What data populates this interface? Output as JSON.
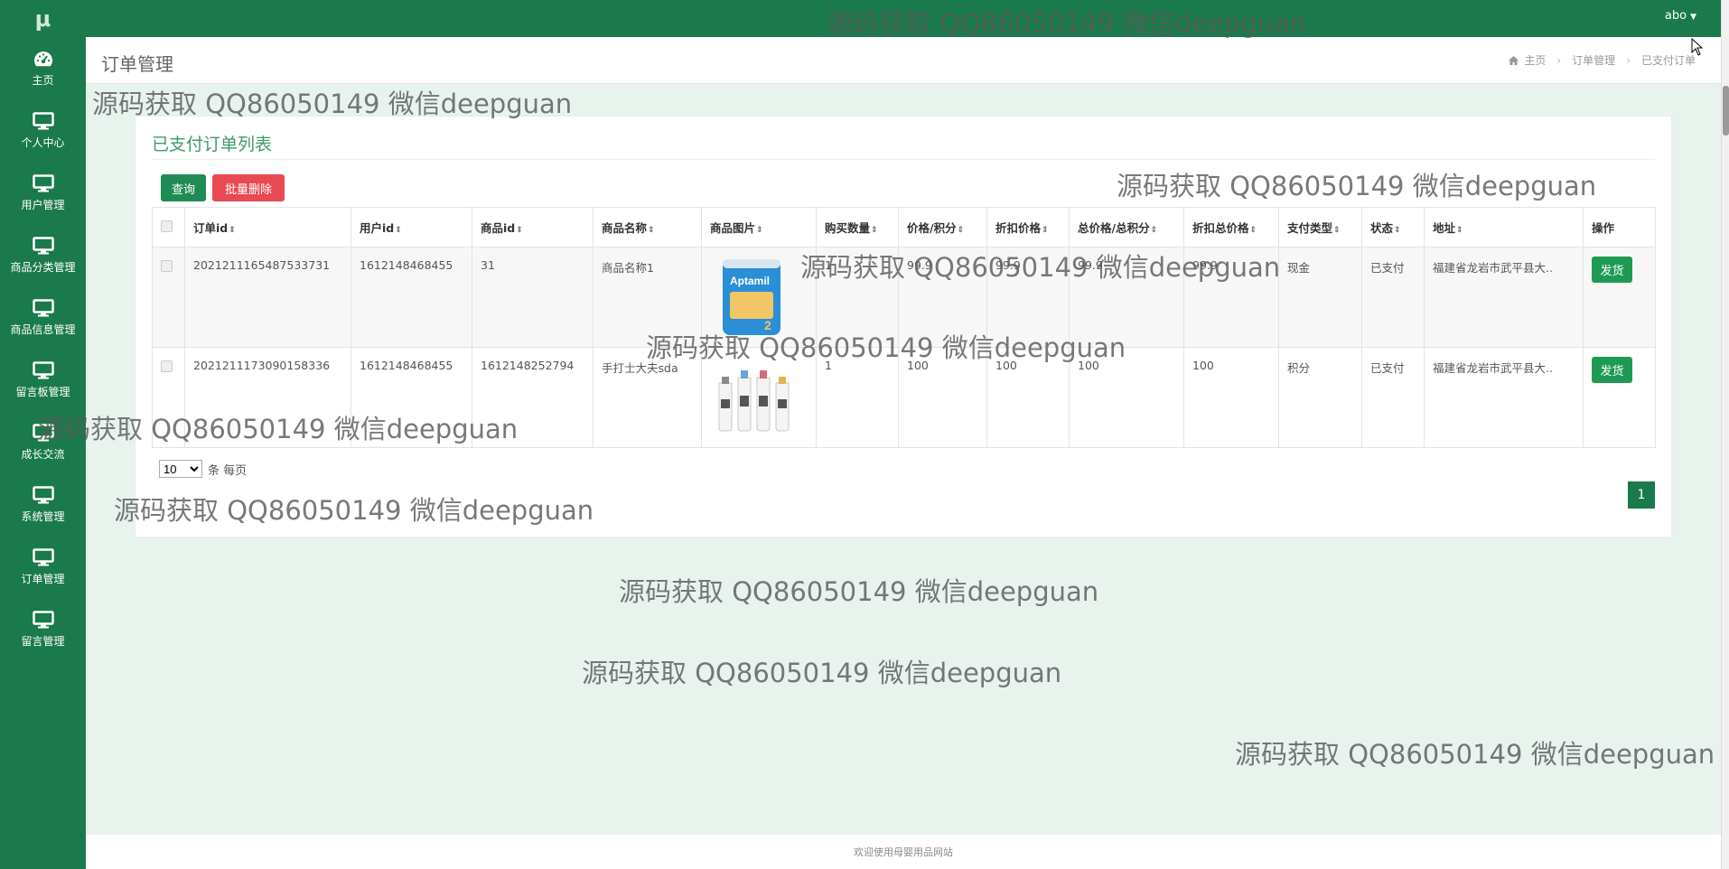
{
  "app": {
    "logo": "μ"
  },
  "user": {
    "name": "abo"
  },
  "sidebar": {
    "items": [
      {
        "label": "主页",
        "icon": "dashboard-icon"
      },
      {
        "label": "个人中心",
        "icon": "monitor-icon"
      },
      {
        "label": "用户管理",
        "icon": "monitor-icon"
      },
      {
        "label": "商品分类管理",
        "icon": "monitor-icon"
      },
      {
        "label": "商品信息管理",
        "icon": "monitor-icon"
      },
      {
        "label": "留言板管理",
        "icon": "monitor-icon"
      },
      {
        "label": "成长交流",
        "icon": "monitor-icon"
      },
      {
        "label": "系统管理",
        "icon": "monitor-icon"
      },
      {
        "label": "订单管理",
        "icon": "monitor-icon"
      },
      {
        "label": "留言管理",
        "icon": "monitor-icon"
      }
    ]
  },
  "header": {
    "title": "订单管理",
    "breadcrumb": {
      "home": "主页",
      "section": "订单管理",
      "current": "已支付订单"
    }
  },
  "card": {
    "title": "已支付订单列表",
    "query_label": "查询",
    "batch_delete_label": "批量删除"
  },
  "table": {
    "columns": [
      "订单id",
      "用户id",
      "商品id",
      "商品名称",
      "商品图片",
      "购买数量",
      "价格/积分",
      "折扣价格",
      "总价格/总积分",
      "折扣总价格",
      "支付类型",
      "状态",
      "地址",
      "操作"
    ],
    "rows": [
      {
        "order_id": "2021211165487533731",
        "user_id": "1612148468455",
        "product_id": "31",
        "product_name": "商品名称1",
        "image": "milk-powder-can-image",
        "quantity": "1",
        "price": "99.9",
        "discount_price": "99.9",
        "total": "99.9",
        "discount_total": "99.9",
        "pay_type": "现金",
        "status": "已支付",
        "address": "福建省龙岩市武平县大..",
        "action": "发货"
      },
      {
        "order_id": "2021211173090158336",
        "user_id": "1612148468455",
        "product_id": "1612148252794",
        "product_name": "手打士大夫sda",
        "image": "milk-bottles-image",
        "quantity": "1",
        "price": "100",
        "discount_price": "100",
        "total": "100",
        "discount_total": "100",
        "pay_type": "积分",
        "status": "已支付",
        "address": "福建省龙岩市武平县大..",
        "action": "发货"
      }
    ]
  },
  "pagination": {
    "page_size": "10",
    "page_size_options": [
      "10"
    ],
    "page_size_suffix": "条 每页",
    "current_page": "1"
  },
  "footer": {
    "text": "欢迎使用母婴用品网站"
  },
  "watermark": {
    "text": "源码获取 QQ86050149 微信deepguan"
  },
  "colors": {
    "primary": "#1a7a4c",
    "danger": "#e84a53",
    "title": "#3d9a6a",
    "background": "#e9f3ee"
  }
}
